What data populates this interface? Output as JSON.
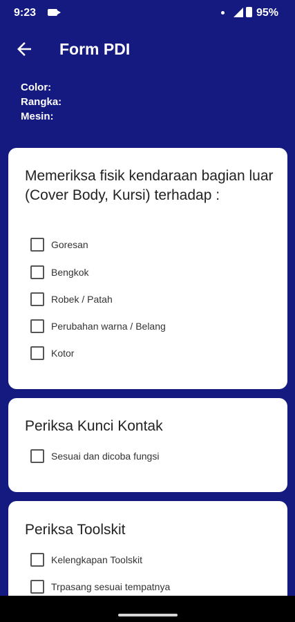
{
  "status": {
    "time": "9:23",
    "battery": "95%"
  },
  "appbar": {
    "title": "Form PDI"
  },
  "info": {
    "color_label": "Color:",
    "rangka_label": "Rangka:",
    "mesin_label": "Mesin:"
  },
  "sections": [
    {
      "title": "Memeriksa fisik kendaraan bagian luar (Cover Body, Kursi) terhadap :",
      "items": [
        "Goresan",
        "Bengkok",
        "Robek / Patah",
        "Perubahan warna / Belang",
        "Kotor"
      ]
    },
    {
      "title": "Periksa Kunci Kontak",
      "items": [
        "Sesuai dan dicoba fungsi"
      ]
    },
    {
      "title": "Periksa Toolskit",
      "items": [
        "Kelengkapan Toolskit",
        "Trpasang sesuai tempatnya"
      ]
    }
  ],
  "icons": {
    "back": "arrow-left-icon",
    "camera": "video-camera-icon",
    "signal": "cellular-signal-icon",
    "battery": "battery-icon"
  }
}
